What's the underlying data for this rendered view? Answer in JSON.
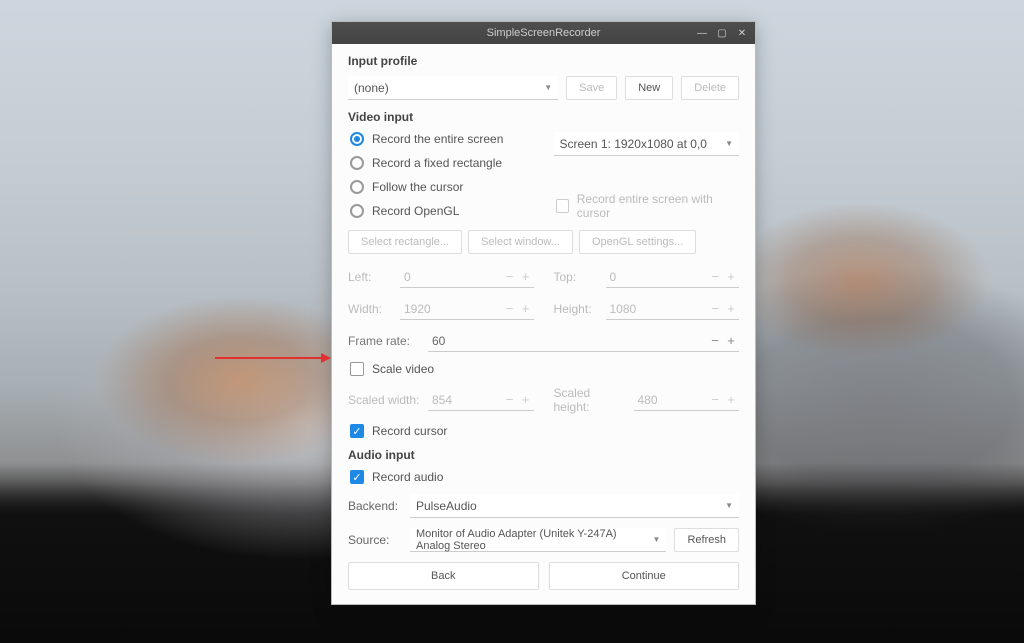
{
  "window": {
    "title": "SimpleScreenRecorder"
  },
  "input_profile": {
    "heading": "Input profile",
    "selected": "(none)",
    "save": "Save",
    "new": "New",
    "delete": "Delete"
  },
  "video_input": {
    "heading": "Video input",
    "radio_entire": "Record the entire screen",
    "radio_rect": "Record a fixed rectangle",
    "radio_cursor": "Follow the cursor",
    "radio_opengl": "Record OpenGL",
    "screen_selected": "Screen 1: 1920x1080 at 0,0",
    "record_entire_with_cursor": "Record entire screen with cursor",
    "btn_select_rect": "Select rectangle...",
    "btn_select_window": "Select window...",
    "btn_opengl_settings": "OpenGL settings...",
    "left_label": "Left:",
    "left_val": "0",
    "top_label": "Top:",
    "top_val": "0",
    "width_label": "Width:",
    "width_val": "1920",
    "height_label": "Height:",
    "height_val": "1080",
    "framerate_label": "Frame rate:",
    "framerate_val": "60",
    "scale_video": "Scale video",
    "scaled_w_label": "Scaled width:",
    "scaled_w_val": "854",
    "scaled_h_label": "Scaled height:",
    "scaled_h_val": "480",
    "record_cursor": "Record cursor"
  },
  "audio_input": {
    "heading": "Audio input",
    "record_audio": "Record audio",
    "backend_label": "Backend:",
    "backend_val": "PulseAudio",
    "source_label": "Source:",
    "source_val": "Monitor of Audio Adapter (Unitek Y-247A) Analog Stereo",
    "refresh": "Refresh"
  },
  "footer": {
    "back": "Back",
    "continue": "Continue"
  }
}
